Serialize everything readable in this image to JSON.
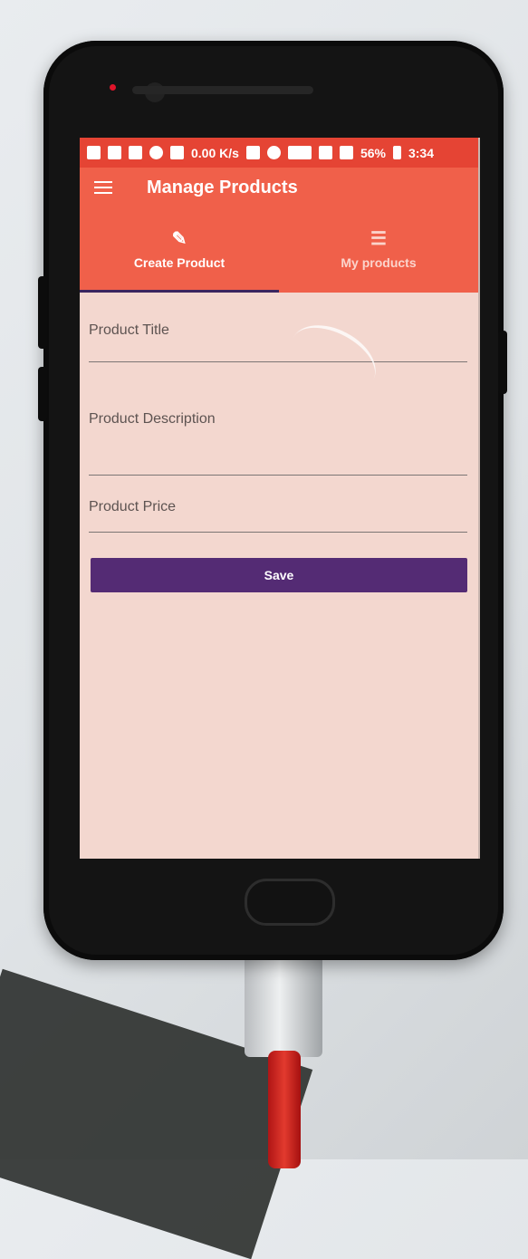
{
  "status_bar": {
    "speed": "0.00 K/s",
    "battery": "56%",
    "time": "3:34"
  },
  "app_bar": {
    "title": "Manage Products",
    "menu_icon": "hamburger-menu-icon"
  },
  "tabs": [
    {
      "label": "Create Product",
      "icon": "pencil-icon",
      "active": true
    },
    {
      "label": "My products",
      "icon": "list-icon",
      "active": false
    }
  ],
  "form": {
    "title_label": "Product Title",
    "description_label": "Product Description",
    "price_label": "Product Price",
    "save_label": "Save"
  },
  "colors": {
    "app_bar": "#f0604a",
    "status_bar": "#e54434",
    "background": "#f3d7cf",
    "save_button": "#542b74",
    "tab_indicator": "#3a255f"
  }
}
